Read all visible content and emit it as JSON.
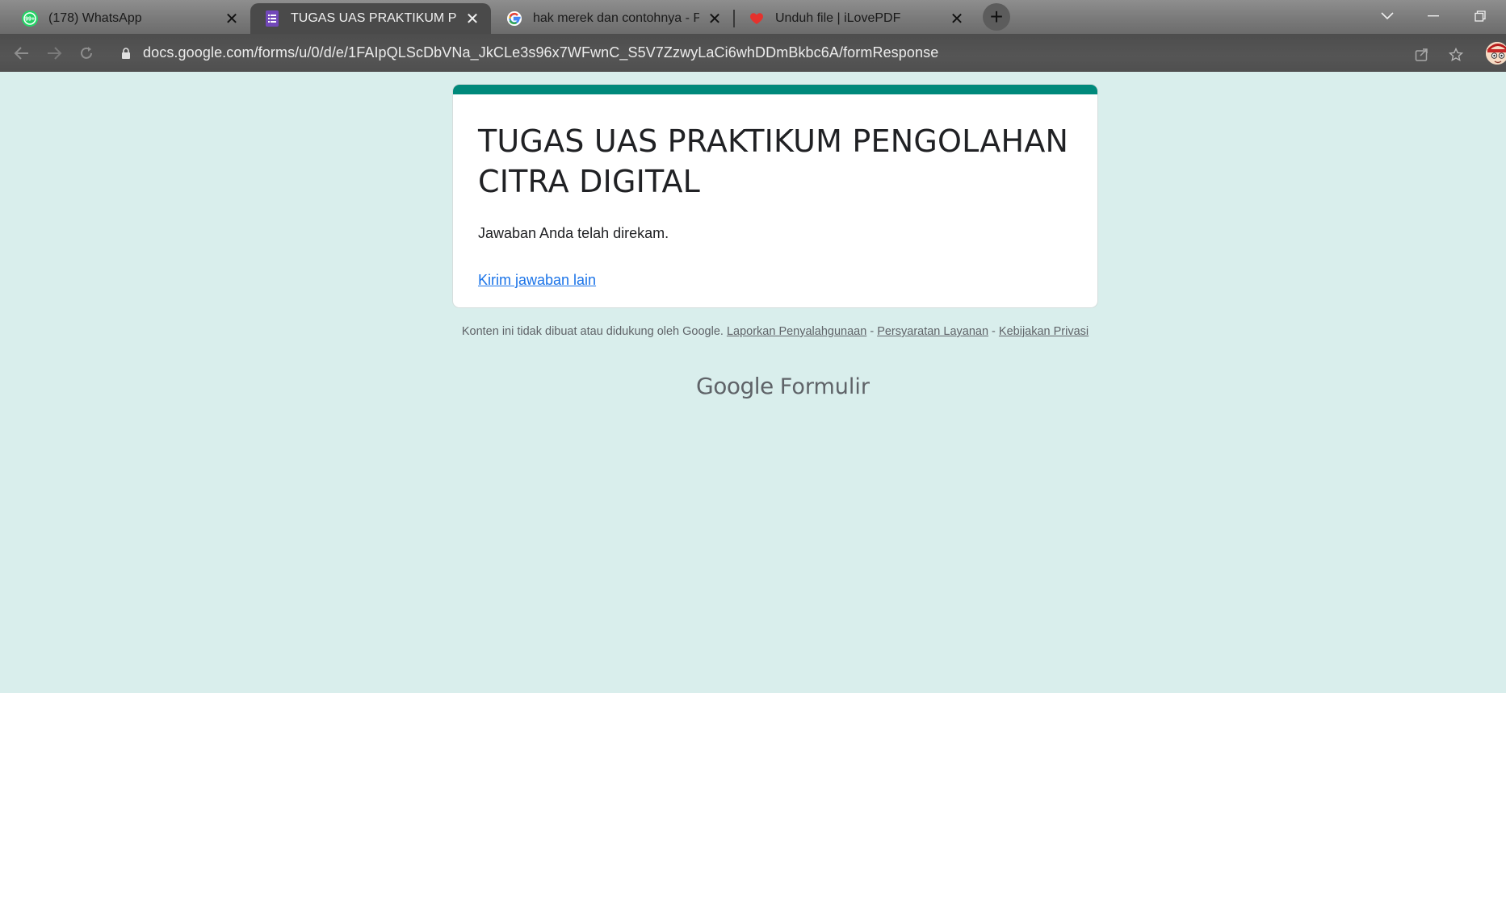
{
  "browser": {
    "tabs": [
      {
        "title": "(178) WhatsApp",
        "favicon": "whatsapp-icon",
        "badge": "99+",
        "active": false
      },
      {
        "title": "TUGAS UAS PRAKTIKUM PENGOLAHAN CITRA DIGITAL",
        "favicon": "google-forms-icon",
        "active": true
      },
      {
        "title": "hak merek dan contohnya - Penelusuran Google",
        "favicon": "google-icon",
        "active": false
      },
      {
        "title": "Unduh file | iLovePDF",
        "favicon": "ilovepdf-icon",
        "active": false
      }
    ],
    "new_tab": "+",
    "url": "docs.google.com/forms/u/0/d/e/1FAIpQLScDbVNa_JkCLe3s96x7WFwnC_S5V7ZzwyLaCi6whDDmBkbc6A/formResponse",
    "colors": {
      "tabstrip": "#7a7a7a",
      "active_tab": "#4a4a4a",
      "toolbar": "#505050"
    }
  },
  "form": {
    "title": "TUGAS UAS PRAKTIKUM PENGOLAHAN CITRA DIGITAL",
    "confirmation": "Jawaban Anda telah direkam.",
    "another_response_link": "Kirim jawaban lain",
    "accent_color": "#00897b",
    "background_color": "#d9eeec"
  },
  "footer": {
    "disclaimer": "Konten ini tidak dibuat atau didukung oleh Google.",
    "links": {
      "abuse": "Laporkan Penyalahgunaan",
      "terms": "Persyaratan Layanan",
      "privacy": "Kebijakan Privasi"
    },
    "separator": " - ",
    "brand_google": "Google",
    "brand_product": "Formulir"
  }
}
